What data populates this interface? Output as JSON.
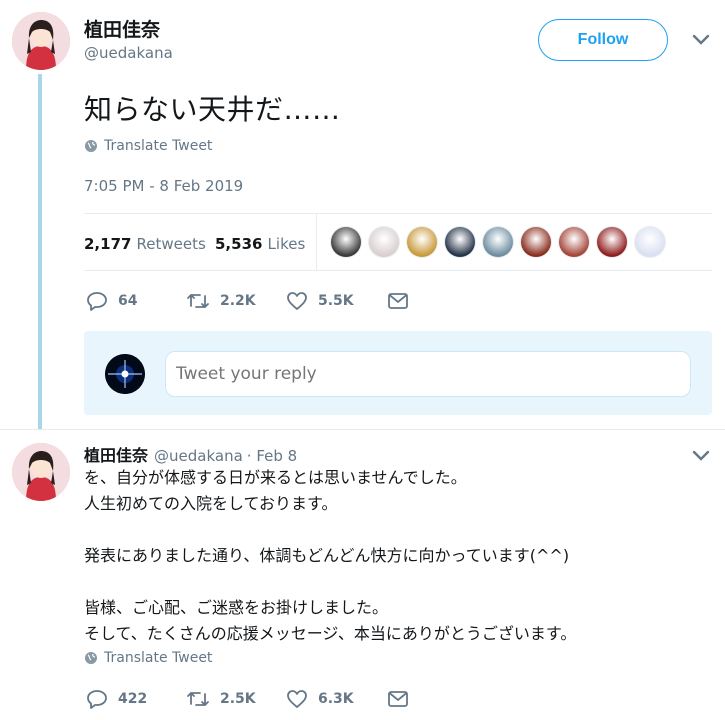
{
  "main_tweet": {
    "author_name": "植田佳奈",
    "author_handle": "@uedakana",
    "follow_label": "Follow",
    "text": "知らない天井だ……",
    "translate_label": "Translate Tweet",
    "timestamp": "7:05 PM - 8 Feb 2019",
    "retweets_count": "2,177",
    "retweets_label": "Retweets",
    "likes_count": "5,536",
    "likes_label": "Likes",
    "liker_colors": [
      "#3b3b3b",
      "#d9cfcf",
      "#c99a3a",
      "#26344a",
      "#6e8ea0",
      "#8a2e1e",
      "#a5463a",
      "#8f1f1f",
      "#d9e0f0"
    ],
    "actions": {
      "replies": "64",
      "retweets": "2.2K",
      "likes": "5.5K"
    }
  },
  "reply_composer": {
    "placeholder": "Tweet your reply"
  },
  "reply_tweet": {
    "author_name": "植田佳奈",
    "author_handle": "@uedakana",
    "date": "· Feb 8",
    "lines": [
      "を、自分が体感する日が来るとは思いませんでした。",
      "人生初めての入院をしております。",
      "",
      "発表にありました通り、体調もどんどん快方に向かっています(^^)",
      "",
      "皆様、ご心配、ご迷惑をお掛けしました。",
      "そして、たくさんの応援メッセージ、本当にありがとうございます。"
    ],
    "translate_label": "Translate Tweet",
    "actions": {
      "replies": "422",
      "retweets": "2.5K",
      "likes": "6.3K"
    }
  },
  "colors": {
    "brand": "#1da1f2",
    "thread_line": "#a9d7e8",
    "muted": "#657786",
    "divider": "#e6ecf0"
  }
}
